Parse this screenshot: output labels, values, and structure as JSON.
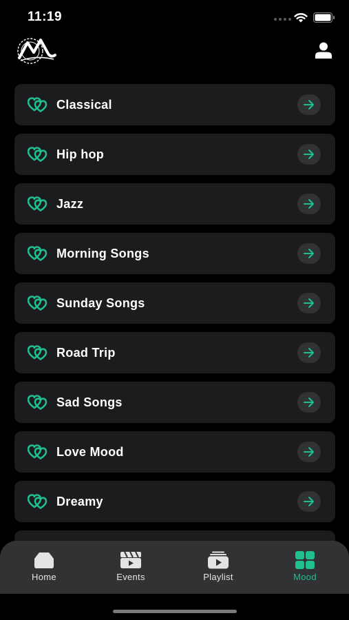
{
  "status_bar": {
    "time": "11:19"
  },
  "moods": [
    {
      "label": "Classical"
    },
    {
      "label": "Hip hop"
    },
    {
      "label": "Jazz"
    },
    {
      "label": "Morning Songs"
    },
    {
      "label": "Sunday Songs"
    },
    {
      "label": "Road Trip"
    },
    {
      "label": "Sad Songs"
    },
    {
      "label": "Love Mood"
    },
    {
      "label": "Dreamy"
    }
  ],
  "tabs": [
    {
      "label": "Home",
      "icon": "home-icon",
      "active": false
    },
    {
      "label": "Events",
      "icon": "clapperboard-icon",
      "active": false
    },
    {
      "label": "Playlist",
      "icon": "playlist-play-icon",
      "active": false
    },
    {
      "label": "Mood",
      "icon": "grid-icon",
      "active": true
    }
  ],
  "colors": {
    "accent": "#1fbf8f",
    "card": "#1c1c1e",
    "tab_bar": "#313233",
    "background": "#000000"
  }
}
